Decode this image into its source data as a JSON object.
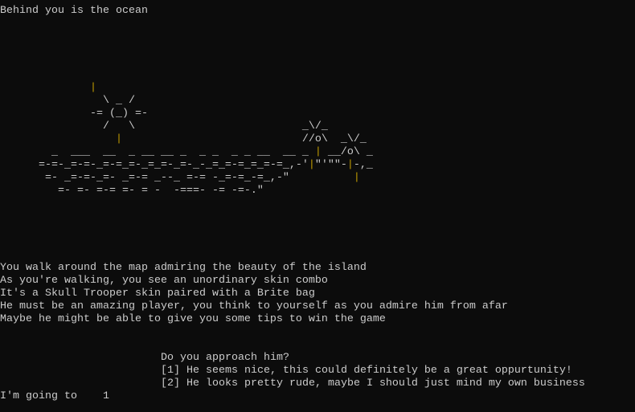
{
  "console": {
    "heading": "Behind you is the ocean",
    "art_color_pipe": "#c19c00",
    "art": [
      [
        [
          "              ",
          ""
        ],
        [
          "|",
          "pipe"
        ]
      ],
      [
        [
          "                \\ _ /",
          ""
        ]
      ],
      [
        [
          "              -= (_) =-",
          ""
        ]
      ],
      [
        [
          "                /   \\                          _\\/_",
          ""
        ]
      ],
      [
        [
          "                  ",
          ""
        ],
        [
          "|",
          "pipe"
        ],
        [
          "                            //o\\  _\\/_",
          ""
        ]
      ],
      [
        [
          "        _  ___  __  _ __ __ _  _ _  _ _ __  __ _ ",
          ""
        ],
        [
          "|",
          "pipe"
        ],
        [
          " __/o\\ _",
          ""
        ]
      ],
      [
        [
          "      =-=-_=-=-_=-=_=-_=_=-_=-_-_=_=-=_=_=-=_,-'",
          ""
        ],
        [
          "|",
          "pipe"
        ],
        [
          "\"'\"\"-",
          ""
        ],
        [
          "|",
          "pipe"
        ],
        [
          "-,_",
          ""
        ]
      ],
      [
        [
          "       =- _=-=-_=- _=-= _--_ =-= -_=-=_-=_,-\"          ",
          ""
        ],
        [
          "|",
          "pipe"
        ]
      ],
      [
        [
          "         =- =- =-= =- = -  -===- -= -=-.\"",
          ""
        ]
      ]
    ],
    "story": [
      "You walk around the map admiring the beauty of the island",
      "As you're walking, you see an unordinary skin combo",
      "It's a Skull Trooper skin paired with a Brite bag",
      "He must be an amazing player, you think to yourself as you admire him from afar",
      "Maybe he might be able to give you some tips to win the game"
    ],
    "question": "Do you approach him?",
    "options": [
      "[1] He seems nice, this could definitely be a great oppurtunity!",
      "[2] He looks pretty rude, maybe I should just mind my own business"
    ],
    "prompt": "I'm going to",
    "input_value": "1"
  }
}
